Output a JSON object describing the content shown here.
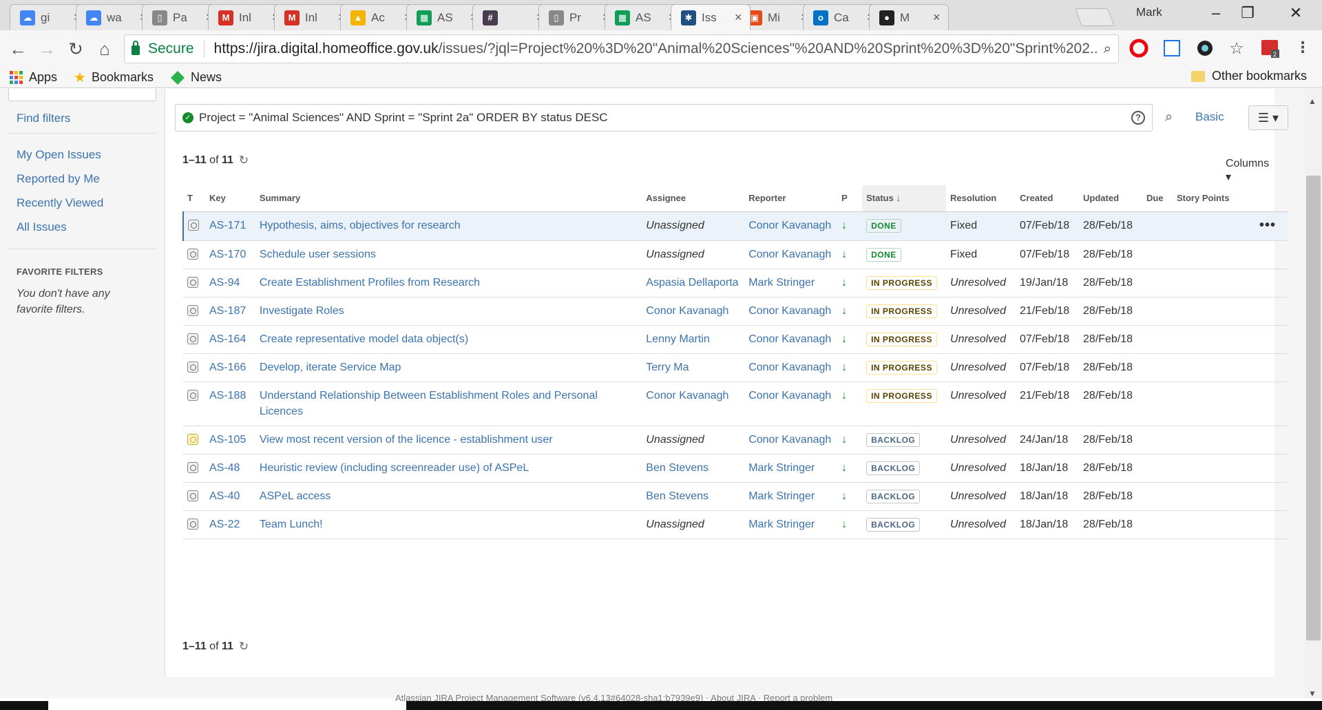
{
  "browser": {
    "tabs": [
      {
        "title": "gi",
        "icon": "cloud-icon",
        "color": "#4285f4"
      },
      {
        "title": "wa",
        "icon": "cloud-icon",
        "color": "#4285f4"
      },
      {
        "title": "Pa",
        "icon": "document-icon",
        "color": "#888888"
      },
      {
        "title": "Inl",
        "icon": "gmail-icon",
        "color": "#d93025"
      },
      {
        "title": "Inl",
        "icon": "gmail-icon",
        "color": "#d93025"
      },
      {
        "title": "Ac",
        "icon": "drive-icon",
        "color": "#f4b400"
      },
      {
        "title": "AS",
        "icon": "sheets-icon",
        "color": "#0f9d58"
      },
      {
        "title": "",
        "icon": "slack-icon",
        "color": "#4a3c4f"
      },
      {
        "title": "Pr",
        "icon": "document-icon",
        "color": "#888888"
      },
      {
        "title": "AS",
        "icon": "sheets-icon",
        "color": "#0f9d58"
      },
      {
        "title": "Iss",
        "icon": "jira-icon",
        "color": "#205081",
        "active": true
      },
      {
        "title": "Mi",
        "icon": "office-icon",
        "color": "#e64a19"
      },
      {
        "title": "Ca",
        "icon": "outlook-icon",
        "color": "#0072c6"
      },
      {
        "title": "M",
        "icon": "github-icon",
        "color": "#222222"
      }
    ],
    "profile": "Mark",
    "secure_label": "Secure",
    "url_host": "https://jira.digital.homeoffice.gov.uk",
    "url_rest": "/issues/?jql=Project%20%3D%20\"Animal%20Sciences\"%20AND%20Sprint%20%3D%20\"Sprint%202...",
    "bookmarks": {
      "apps": "Apps",
      "bookmarks": "Bookmarks",
      "news": "News",
      "other": "Other bookmarks"
    }
  },
  "sidebar": {
    "find_filters": "Find filters",
    "links": [
      "My Open Issues",
      "Reported by Me",
      "Recently Viewed",
      "All Issues"
    ],
    "favorite_heading": "FAVORITE FILTERS",
    "favorite_empty": "You don't have any favorite filters."
  },
  "search": {
    "jql": "Project = \"Animal Sciences\" AND Sprint = \"Sprint 2a\" ORDER BY status DESC",
    "basic_label": "Basic",
    "count_range": "1–11",
    "count_of": "of",
    "count_total": "11",
    "columns_label": "Columns"
  },
  "table": {
    "headers": {
      "type": "T",
      "key": "Key",
      "summary": "Summary",
      "assignee": "Assignee",
      "reporter": "Reporter",
      "priority": "P",
      "status": "Status",
      "resolution": "Resolution",
      "created": "Created",
      "updated": "Updated",
      "due": "Due",
      "story_points": "Story Points"
    },
    "rows": [
      {
        "type": "story",
        "key": "AS-171",
        "summary": "Hypothesis, aims, objectives for research",
        "assignee": "Unassigned",
        "assignee_unassigned": true,
        "reporter": "Conor Kavanagh",
        "status": "DONE",
        "status_kind": "done",
        "resolution": "Fixed",
        "created": "07/Feb/18",
        "updated": "28/Feb/18",
        "selected": true
      },
      {
        "type": "story",
        "key": "AS-170",
        "summary": "Schedule user sessions",
        "assignee": "Unassigned",
        "assignee_unassigned": true,
        "reporter": "Conor Kavanagh",
        "status": "DONE",
        "status_kind": "done",
        "resolution": "Fixed",
        "created": "07/Feb/18",
        "updated": "28/Feb/18"
      },
      {
        "type": "story",
        "key": "AS-94",
        "summary": "Create Establishment Profiles from Research",
        "assignee": "Aspasia Dellaporta",
        "reporter": "Mark Stringer",
        "status": "IN PROGRESS",
        "status_kind": "progress",
        "resolution": "Unresolved",
        "created": "19/Jan/18",
        "updated": "28/Feb/18"
      },
      {
        "type": "story",
        "key": "AS-187",
        "summary": "Investigate Roles",
        "assignee": "Conor Kavanagh",
        "reporter": "Conor Kavanagh",
        "status": "IN PROGRESS",
        "status_kind": "progress",
        "resolution": "Unresolved",
        "created": "21/Feb/18",
        "updated": "28/Feb/18"
      },
      {
        "type": "story",
        "key": "AS-164",
        "summary": "Create representative model data object(s)",
        "assignee": "Lenny Martin",
        "reporter": "Conor Kavanagh",
        "status": "IN PROGRESS",
        "status_kind": "progress",
        "resolution": "Unresolved",
        "created": "07/Feb/18",
        "updated": "28/Feb/18"
      },
      {
        "type": "story",
        "key": "AS-166",
        "summary": "Develop, iterate Service Map",
        "assignee": "Terry Ma",
        "reporter": "Conor Kavanagh",
        "status": "IN PROGRESS",
        "status_kind": "progress",
        "resolution": "Unresolved",
        "created": "07/Feb/18",
        "updated": "28/Feb/18"
      },
      {
        "type": "story",
        "key": "AS-188",
        "summary": "Understand Relationship Between Establishment Roles and Personal Licences",
        "assignee": "Conor Kavanagh",
        "reporter": "Conor Kavanagh",
        "status": "IN PROGRESS",
        "status_kind": "progress",
        "resolution": "Unresolved",
        "created": "21/Feb/18",
        "updated": "28/Feb/18"
      },
      {
        "type": "improvement",
        "key": "AS-105",
        "summary": "View most recent version of the licence - establishment user",
        "assignee": "Unassigned",
        "assignee_unassigned": true,
        "reporter": "Conor Kavanagh",
        "status": "BACKLOG",
        "status_kind": "backlog",
        "resolution": "Unresolved",
        "created": "24/Jan/18",
        "updated": "28/Feb/18"
      },
      {
        "type": "story",
        "key": "AS-48",
        "summary": "Heuristic review (including screenreader use) of ASPeL",
        "assignee": "Ben Stevens",
        "reporter": "Mark Stringer",
        "status": "BACKLOG",
        "status_kind": "backlog",
        "resolution": "Unresolved",
        "created": "18/Jan/18",
        "updated": "28/Feb/18"
      },
      {
        "type": "story",
        "key": "AS-40",
        "summary": "ASPeL access",
        "assignee": "Ben Stevens",
        "reporter": "Mark Stringer",
        "status": "BACKLOG",
        "status_kind": "backlog",
        "resolution": "Unresolved",
        "created": "18/Jan/18",
        "updated": "28/Feb/18"
      },
      {
        "type": "story",
        "key": "AS-22",
        "summary": "Team Lunch!",
        "assignee": "Unassigned",
        "assignee_unassigned": true,
        "reporter": "Mark Stringer",
        "status": "BACKLOG",
        "status_kind": "backlog",
        "resolution": "Unresolved",
        "created": "18/Jan/18",
        "updated": "28/Feb/18"
      }
    ]
  },
  "footer": {
    "text": "Atlassian JIRA Project Management Software (v6.4.13#64028-sha1:b7939e9) · About JIRA · Report a problem"
  }
}
